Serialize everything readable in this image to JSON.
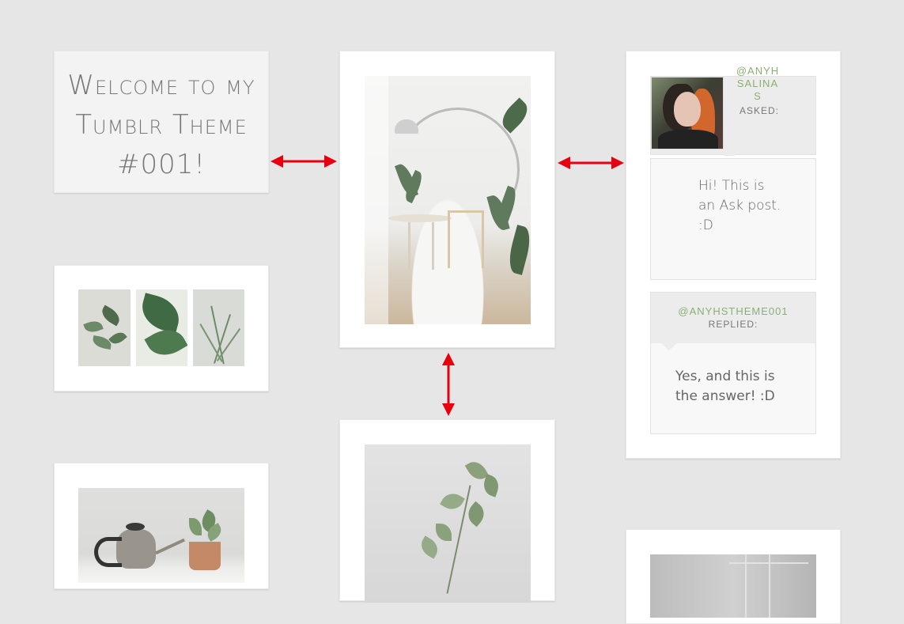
{
  "title_card": {
    "heading": "Welcome to my Tumblr Theme #001!"
  },
  "ask_post": {
    "asker": "@ANYHSALINAS",
    "asked_label": "ASKED:",
    "question": "Hi! This is an Ask post. :D",
    "replier": "@ANYHSTHEME001",
    "replied_label": "REPLIED:",
    "answer": "Yes, and this is the answer! :D"
  },
  "images": [
    {
      "name": "room-interior-photo"
    },
    {
      "name": "plant-photo-1"
    },
    {
      "name": "monstera-leaf-photo"
    },
    {
      "name": "spiky-plant-photo"
    },
    {
      "name": "kettle-and-pot-photo"
    },
    {
      "name": "eucalyptus-branch-photo"
    },
    {
      "name": "gray-window-photo"
    }
  ],
  "annotation_color": "#e8000f"
}
